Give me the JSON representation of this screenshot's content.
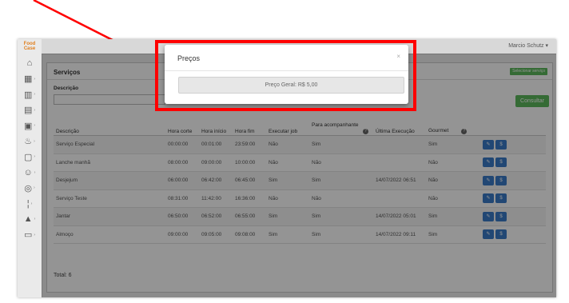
{
  "app": {
    "logo_line1": "Food",
    "logo_line2": "Case",
    "user_name": "Marcio Schutz ▾"
  },
  "sidebar": {
    "items": [
      {
        "icon": "home-icon",
        "glyph": "⌂"
      },
      {
        "icon": "grid-icon",
        "glyph": "▦"
      },
      {
        "icon": "chart-icon",
        "glyph": "▥"
      },
      {
        "icon": "box-icon",
        "glyph": "▤"
      },
      {
        "icon": "clipboard-icon",
        "glyph": "▣"
      },
      {
        "icon": "kitchen-icon",
        "glyph": "♨"
      },
      {
        "icon": "document-icon",
        "glyph": "▢"
      },
      {
        "icon": "people-icon",
        "glyph": "☺"
      },
      {
        "icon": "dishes-icon",
        "glyph": "◎"
      },
      {
        "icon": "thermometer-icon",
        "glyph": "¦"
      },
      {
        "icon": "flask-icon",
        "glyph": "▲"
      },
      {
        "icon": "monitor-icon",
        "glyph": "▭"
      }
    ]
  },
  "panel": {
    "title": "Serviços",
    "select_service_label": "Selecionar serviço",
    "description_label": "Descrição",
    "description_value": "",
    "consult_label": "Consultar",
    "total": "Total: 6"
  },
  "table": {
    "headers": [
      "Descrição",
      "Hora corte",
      "Hora início",
      "Hora fim",
      "Executar job",
      "Para acompanhante",
      "Última Execução",
      "Gourmet",
      ""
    ],
    "rows": [
      [
        "Serviço Especial",
        "00:00:00",
        "00:01:00",
        "23:59:00",
        "Não",
        "Sim",
        "",
        "Sim"
      ],
      [
        "Lanche manhã",
        "08:00:00",
        "09:00:00",
        "10:00:00",
        "Não",
        "Não",
        "",
        "Não"
      ],
      [
        "Desjejum",
        "06:00:00",
        "06:42:00",
        "06:45:00",
        "Sim",
        "Sim",
        "14/07/2022 06:51",
        "Não"
      ],
      [
        "Serviço Teste",
        "08:31:00",
        "11:42:00",
        "16:36:00",
        "Não",
        "Não",
        "",
        "Não"
      ],
      [
        "Jantar",
        "06:50:00",
        "06:52:00",
        "06:55:00",
        "Sim",
        "Sim",
        "14/07/2022 05:01",
        "Sim"
      ],
      [
        "Almoço",
        "09:00:00",
        "09:05:00",
        "09:08:00",
        "Sim",
        "Sim",
        "14/07/2022 09:11",
        "Sim"
      ]
    ],
    "edit_glyph": "✎",
    "delete_glyph": "$"
  },
  "modal": {
    "title": "Preços",
    "close": "×",
    "price_text": "Preço Geral: R$ 5,00"
  },
  "colors": {
    "highlight": "#ff0000",
    "accent": "#5cb85c",
    "action": "#3a7bc8"
  }
}
